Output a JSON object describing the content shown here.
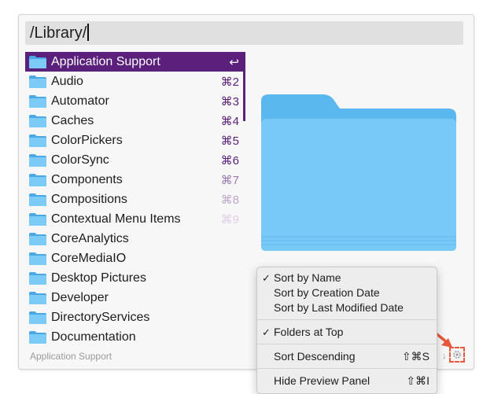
{
  "search": {
    "value": "/Library/"
  },
  "colors": {
    "selection": "#5b1f7c",
    "folder": "#5ab8ee",
    "highlight_annotation": "#e8593c"
  },
  "list": {
    "items": [
      {
        "label": "Application Support",
        "shortcut": "↩",
        "selected": true
      },
      {
        "label": "Audio",
        "shortcut": "⌘2"
      },
      {
        "label": "Automator",
        "shortcut": "⌘3"
      },
      {
        "label": "Caches",
        "shortcut": "⌘4"
      },
      {
        "label": "ColorPickers",
        "shortcut": "⌘5"
      },
      {
        "label": "ColorSync",
        "shortcut": "⌘6"
      },
      {
        "label": "Components",
        "shortcut": "⌘7"
      },
      {
        "label": "Compositions",
        "shortcut": "⌘8"
      },
      {
        "label": "Contextual Menu Items",
        "shortcut": "⌘9"
      },
      {
        "label": "CoreAnalytics",
        "shortcut": ""
      },
      {
        "label": "CoreMediaIO",
        "shortcut": ""
      },
      {
        "label": "Desktop Pictures",
        "shortcut": ""
      },
      {
        "label": "Developer",
        "shortcut": ""
      },
      {
        "label": "DirectoryServices",
        "shortcut": ""
      },
      {
        "label": "Documentation",
        "shortcut": ""
      }
    ]
  },
  "footer": {
    "selected_label": "Application Support",
    "sort_indicator": "↓",
    "gear_icon": "gear-icon"
  },
  "menu": {
    "sort_by_name": {
      "label": "Sort by Name",
      "check": "✓"
    },
    "sort_by_creation": {
      "label": "Sort by Creation Date"
    },
    "sort_by_modified": {
      "label": "Sort by Last Modified Date"
    },
    "folders_at_top": {
      "label": "Folders at Top",
      "check": "✓"
    },
    "sort_descending": {
      "label": "Sort Descending",
      "shortcut": "⇧⌘S"
    },
    "hide_preview": {
      "label": "Hide Preview Panel",
      "shortcut": "⇧⌘I"
    }
  }
}
